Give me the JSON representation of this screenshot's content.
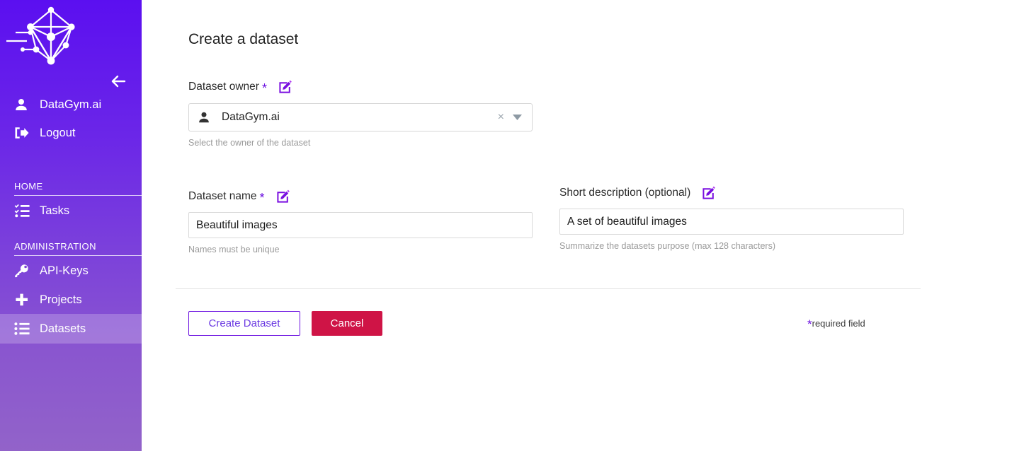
{
  "theme": {
    "sidebar_gradient_top": "#5b0ff0",
    "sidebar_gradient_bottom": "#9263c9",
    "accent_purple": "#6b10e0",
    "cancel_red": "#cf1446",
    "hint_gray": "#9a9a9a"
  },
  "sidebar": {
    "logo_name": "datagym-logo",
    "collapse_label": "back-arrow",
    "account": {
      "label": "DataGym.ai",
      "icon": "person-icon"
    },
    "logout": {
      "label": "Logout",
      "icon": "logout-icon"
    },
    "sections": [
      {
        "heading": "HOME",
        "items": [
          {
            "label": "Tasks",
            "icon": "checklist-icon",
            "active": false
          }
        ]
      },
      {
        "heading": "ADMINISTRATION",
        "items": [
          {
            "label": "API-Keys",
            "icon": "key-icon",
            "active": false
          },
          {
            "label": "Projects",
            "icon": "plus-icon",
            "active": false
          },
          {
            "label": "Datasets",
            "icon": "list-icon",
            "active": true
          }
        ]
      }
    ]
  },
  "main": {
    "title": "Create a dataset",
    "owner": {
      "label": "Dataset owner",
      "required_marker": "*",
      "edit_icon": "edit-pencil-icon",
      "value": "DataGym.ai",
      "value_icon": "person-icon",
      "clear_icon": "×",
      "dropdown_icon": "chevron-down-icon",
      "hint": "Select the owner of the dataset"
    },
    "name": {
      "label": "Dataset name",
      "required_marker": "*",
      "edit_icon": "edit-pencil-icon",
      "value": "Beautiful images",
      "placeholder": "",
      "hint": "Names must be unique"
    },
    "description": {
      "label": "Short description (optional)",
      "edit_icon": "edit-pencil-icon",
      "value": "A set of beautiful images",
      "placeholder": "",
      "hint": "Summarize the datasets purpose (max 128 characters)"
    },
    "actions": {
      "create_label": "Create Dataset",
      "cancel_label": "Cancel"
    },
    "required_note": {
      "star": "*",
      "text": "required field"
    }
  }
}
